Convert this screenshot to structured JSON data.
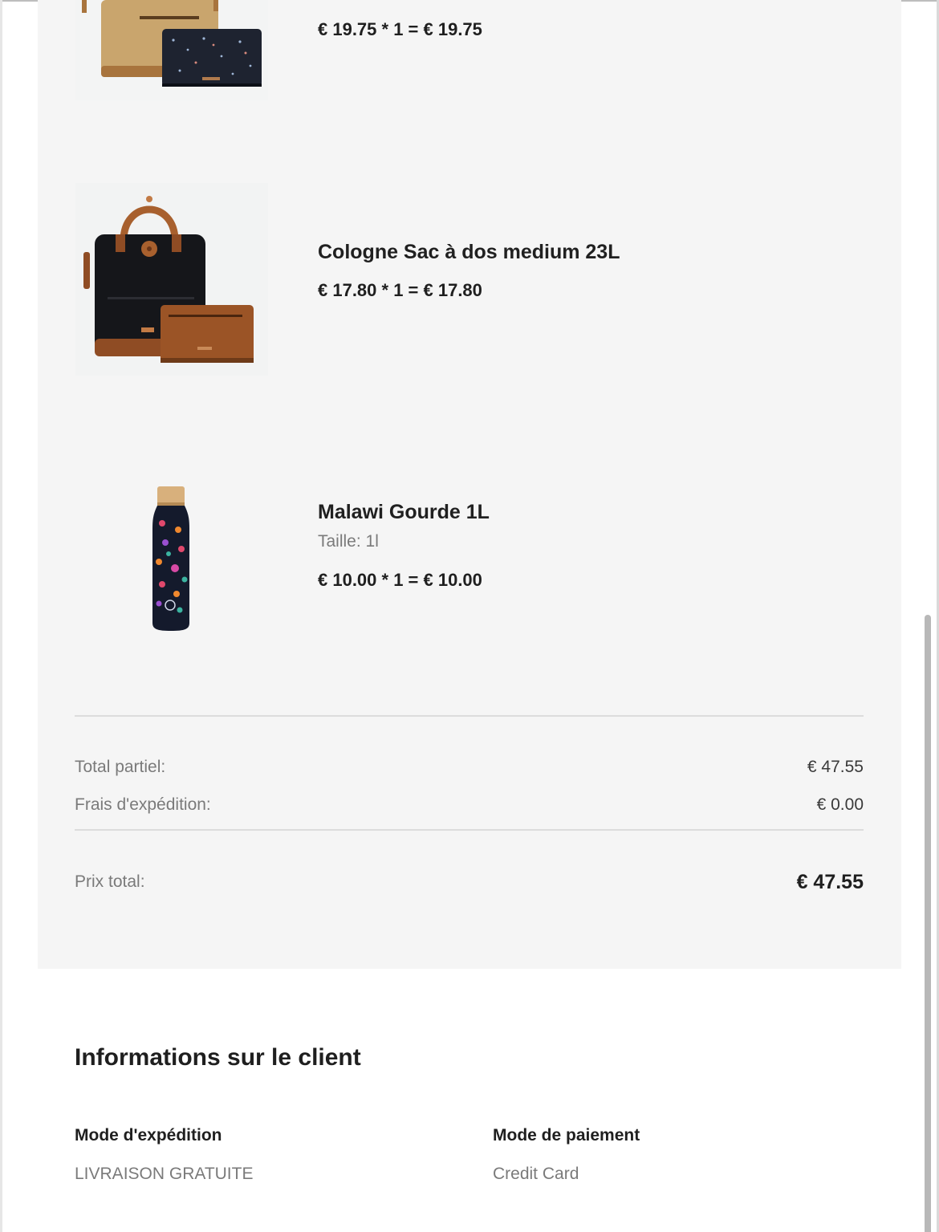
{
  "items": [
    {
      "image_icon": "backpack-tan-with-black-pouch-image",
      "price_line": "€ 19.75 * 1 = € 19.75"
    },
    {
      "image_icon": "backpack-black-with-brown-pouch-image",
      "name": "Cologne Sac à dos medium 23L",
      "price_line": "€ 17.80 * 1 = € 17.80"
    },
    {
      "image_icon": "floral-water-bottle-image",
      "name": "Malawi Gourde 1L",
      "variant": "Taille: 1l",
      "price_line": "€ 10.00 * 1 = € 10.00"
    }
  ],
  "summary": {
    "subtotal_label": "Total partiel:",
    "subtotal_value": "€ 47.55",
    "shipping_label": "Frais d'expédition:",
    "shipping_value": "€ 0.00",
    "total_label": "Prix total:",
    "total_value": "€ 47.55"
  },
  "customer": {
    "title": "Informations sur le client",
    "shipping_method_label": "Mode d'expédition",
    "shipping_method_value": "LIVRAISON GRATUITE",
    "payment_method_label": "Mode de paiement",
    "payment_method_value": "Credit Card"
  },
  "colors": {
    "panel_bg": "#f5f5f5",
    "text_dark": "#1f1f1f",
    "text_muted": "#7a7a7a",
    "divider": "#dcdcdc"
  }
}
